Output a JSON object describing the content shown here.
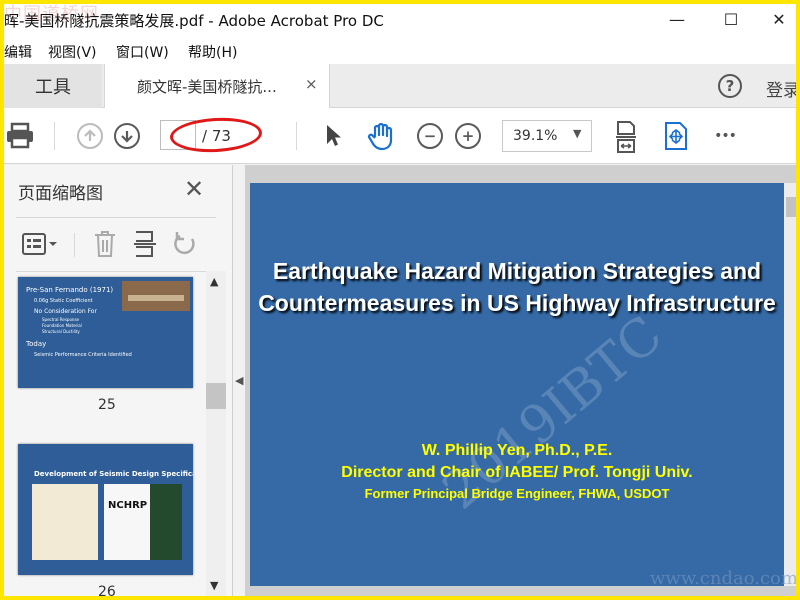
{
  "window": {
    "title": "晖-美国桥隧抗震策略发展.pdf - Adobe Acrobat Pro DC",
    "watermark_logo": "中国道桥网",
    "minimize": "—",
    "maximize": "☐",
    "close": "✕"
  },
  "menu": {
    "items": [
      "编辑",
      "视图(V)",
      "窗口(W)",
      "帮助(H)"
    ]
  },
  "tabs": {
    "tools_label": "工具",
    "doc_tab_label": "颜文晖-美国桥隧抗...",
    "doc_tab_close": "×",
    "help_label": "?",
    "login_label": "登录"
  },
  "toolbar": {
    "page_input_value": "",
    "page_total": "/ 73",
    "zoom_value": "39.1%",
    "zoom_caret": "▼",
    "more_label": "•••",
    "zoom_out_label": "−",
    "zoom_in_label": "+"
  },
  "thumbnail_panel": {
    "title": "页面缩略图",
    "close": "✕",
    "scroll_up": "▲",
    "scroll_down": "▼",
    "thumbnails": [
      {
        "page_number": "25",
        "lines": [
          "Pre-San Fernando (1971)",
          "0.06g Static Coefficient",
          "No Consideration For",
          "Spectral Response",
          "Foundation Material",
          "Structural Ductility",
          "Today",
          "Seismic Performance Criteria Identified"
        ]
      },
      {
        "page_number": "26",
        "heading": "Development of Seismic Design Specifications",
        "nchrp_label": "NCHRP"
      }
    ]
  },
  "document": {
    "slide_title_line1": "Earthquake Hazard Mitigation Strategies and",
    "slide_title_line2": "Countermeasures in US Highway Infrastructure",
    "author": "W. Phillip Yen, Ph.D., P.E.",
    "position": "Director and Chair of IABEE/ Prof. Tongji Univ.",
    "former": "Former Principal Bridge Engineer, FHWA, USDOT",
    "watermark": "2019IBTC",
    "site_watermark": "www.cndao.com"
  },
  "colors": {
    "slide_background": "#356aa6",
    "highlight_ellipse": "#e01818",
    "frame_border": "#ffe600",
    "author_text": "#ffff00"
  }
}
